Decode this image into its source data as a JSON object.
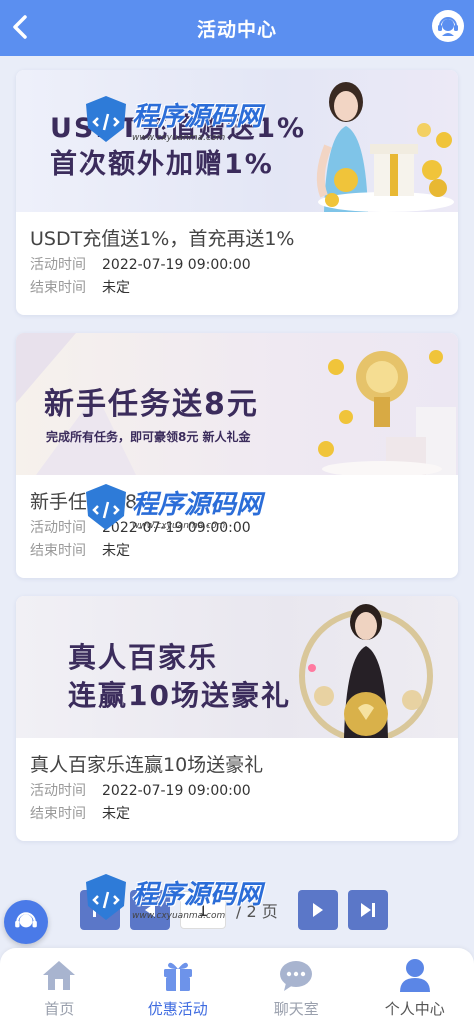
{
  "header": {
    "title": "活动中心",
    "back_icon": "back-arrow-icon",
    "support_icon": "customer-service-icon"
  },
  "activities": [
    {
      "name": "USDT充值送1%，首充再送1%",
      "banner_line1": "USDT充值赠送1%",
      "banner_line2": "首次额外加赠1%",
      "start_label": "活动时间",
      "start_value": "2022-07-19 09:00:00",
      "end_label": "结束时间",
      "end_value": "未定"
    },
    {
      "name": "新手任务送8元",
      "banner_line1": "新手任务送8元",
      "banner_line2": "完成所有任务，即可豪领8元 新人礼金",
      "start_label": "活动时间",
      "start_value": "2022-07-19 09:00:00",
      "end_label": "结束时间",
      "end_value": "未定"
    },
    {
      "name": "真人百家乐连赢10场送豪礼",
      "banner_line1": "真人百家乐",
      "banner_line2": "连赢10场送豪礼",
      "start_label": "活动时间",
      "start_value": "2022-07-19 09:00:00",
      "end_label": "结束时间",
      "end_value": "未定"
    }
  ],
  "pager": {
    "current": "1",
    "total_text": "/ 2 页"
  },
  "watermark": {
    "text": "程序源码网",
    "sub": "www.cxyuanma.com"
  },
  "nav": [
    {
      "label": "首页",
      "icon": "home-icon"
    },
    {
      "label": "优惠活动",
      "icon": "gift-icon"
    },
    {
      "label": "聊天室",
      "icon": "chat-icon"
    },
    {
      "label": "个人中心",
      "icon": "user-icon"
    }
  ],
  "colors": {
    "primary": "#5b8ff0",
    "active": "#3e6be0",
    "pager_btn": "#5b77c8"
  }
}
